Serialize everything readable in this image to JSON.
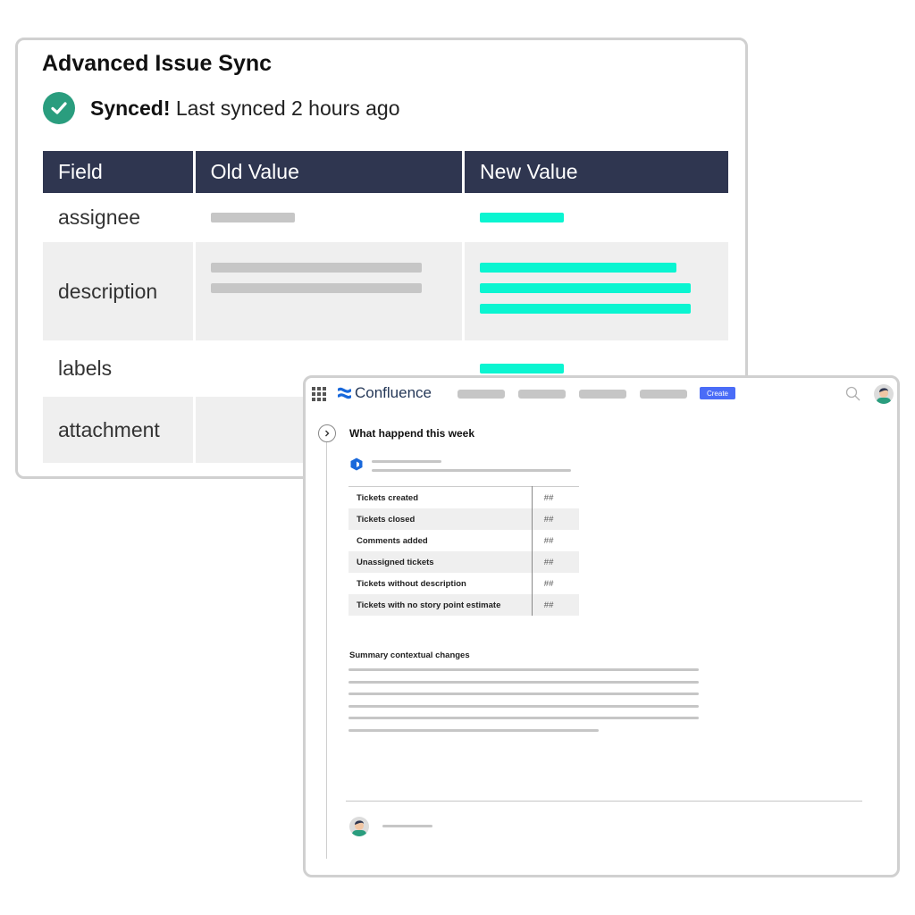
{
  "sync_card": {
    "title": "Advanced Issue Sync",
    "status_bold": "Synced!",
    "status_text": "Last synced 2 hours ago",
    "columns": [
      "Field",
      "Old Value",
      "New Value"
    ],
    "rows": [
      {
        "field": "assignee"
      },
      {
        "field": "description"
      },
      {
        "field": "labels"
      },
      {
        "field": "attachment"
      }
    ],
    "colors": {
      "header_bg": "#2f3650",
      "new_value": "#0af5d1",
      "old_value": "#c6c6c6",
      "check": "#2a9d7e"
    }
  },
  "confluence": {
    "app_name": "Confluence",
    "create_label": "Create",
    "page_title": "What happend this week",
    "stats": [
      {
        "label": "Tickets created",
        "value": "##"
      },
      {
        "label": "Tickets closed",
        "value": "##"
      },
      {
        "label": "Comments added",
        "value": "##"
      },
      {
        "label": "Unassigned tickets",
        "value": "##"
      },
      {
        "label": "Tickets without description",
        "value": "##"
      },
      {
        "label": "Tickets with no story point estimate",
        "value": "##"
      }
    ],
    "summary_title": "Summary contextual changes",
    "icons": [
      "apps-grid-icon",
      "confluence-logo-icon",
      "search-icon",
      "user-avatar",
      "chevron-right-icon",
      "app-hexagon-icon"
    ],
    "colors": {
      "create_button": "#4a6cf7",
      "logo": "#1868db"
    }
  }
}
